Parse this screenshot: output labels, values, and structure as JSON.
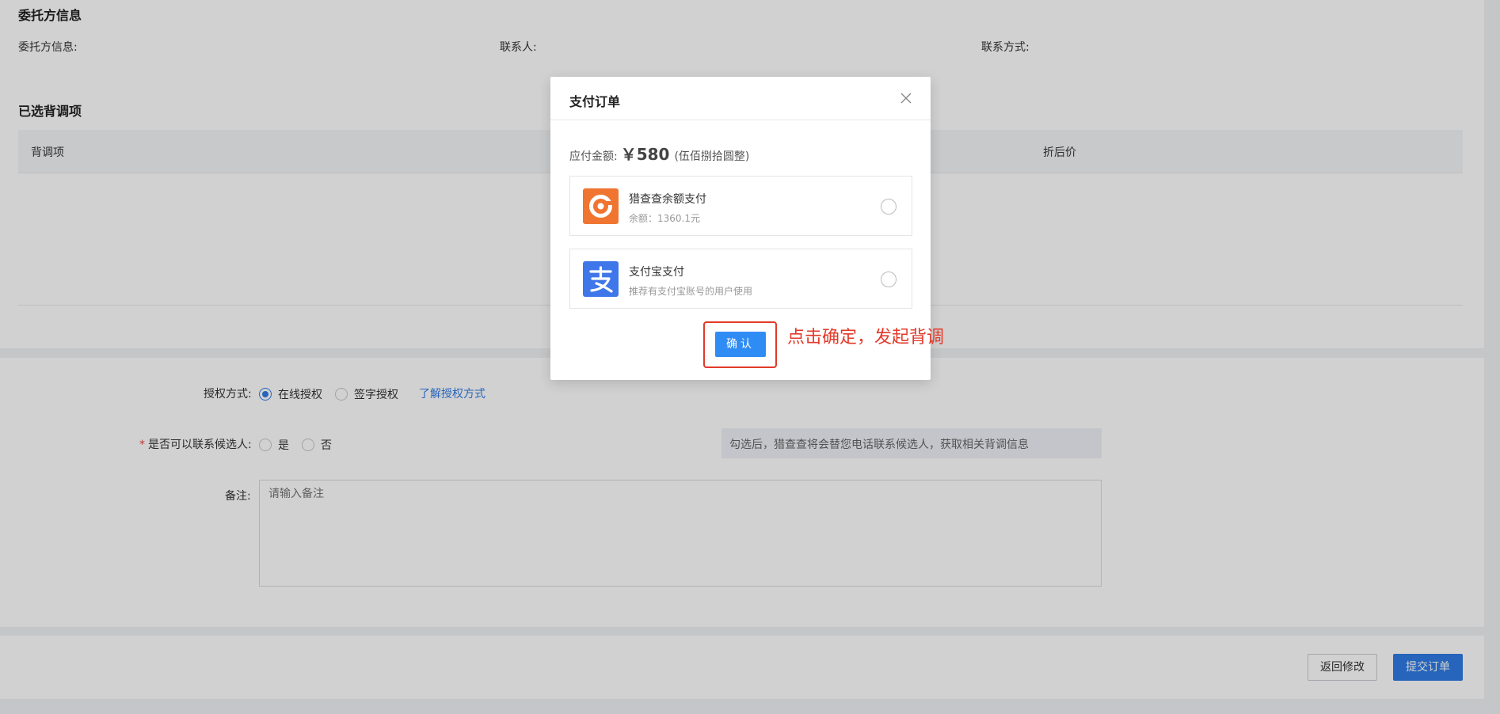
{
  "client": {
    "section_title": "委托方信息",
    "client_info_label": "委托方信息:",
    "contact_label": "联系人:",
    "contact_method_label": "联系方式:"
  },
  "selected": {
    "section_title": "已选背调项",
    "columns": [
      "背调项",
      "折后价"
    ]
  },
  "form": {
    "auth_label": "授权方式:",
    "auth_options": [
      "在线授权",
      "签字授权"
    ],
    "auth_selected": "在线授权",
    "auth_link": "了解授权方式",
    "contact_candidate_label": "是否可以联系候选人:",
    "contact_candidate_options": [
      "是",
      "否"
    ],
    "contact_hint": "勾选后，猎查查将会替您电话联系候选人，获取相关背调信息",
    "remark_label": "备注:",
    "remark_placeholder": "请输入备注"
  },
  "footer": {
    "back_button": "返回修改",
    "submit_button": "提交订单"
  },
  "modal": {
    "title": "支付订单",
    "amount_label": "应付金额:",
    "amount_value": "￥580",
    "amount_words": "(伍佰捌拾圆整)",
    "options": [
      {
        "name": "猎查查余额支付",
        "sub": "余额：1360.1元",
        "icon": "liechacha-logo-icon"
      },
      {
        "name": "支付宝支付",
        "sub": "推荐有支付宝账号的用户使用",
        "icon": "alipay-logo-icon"
      }
    ],
    "confirm_button": "确认"
  },
  "annotation": {
    "text": "点击确定，发起背调",
    "color": "#e23a2a"
  },
  "colors": {
    "primary": "#2f7ce5",
    "alipay": "#3f77ea",
    "liechacha": "#f07530"
  }
}
